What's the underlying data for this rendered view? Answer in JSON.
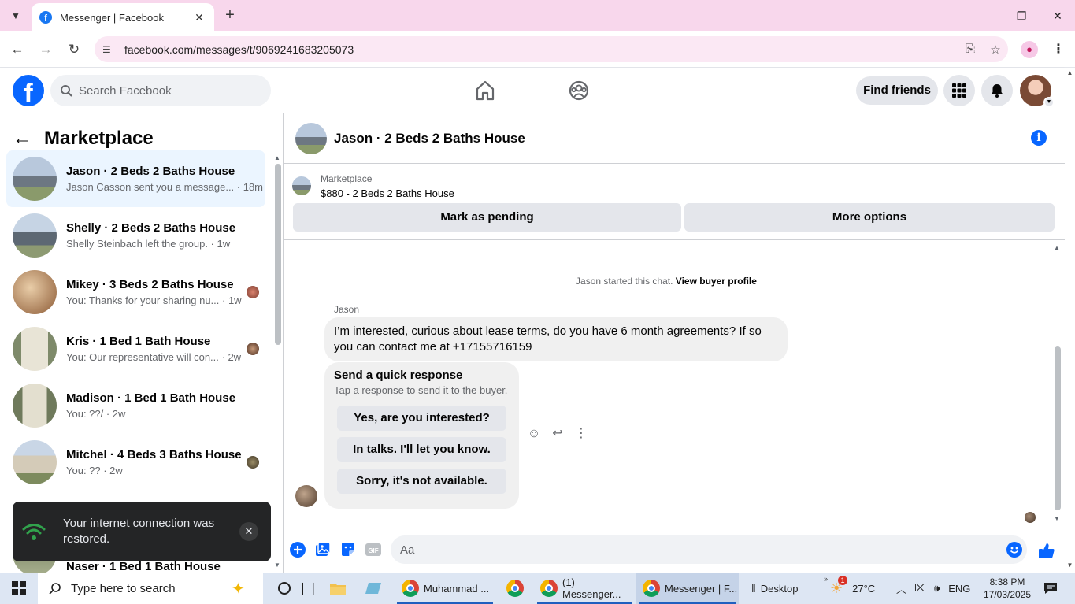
{
  "browser": {
    "tab_title": "Messenger | Facebook",
    "url": "facebook.com/messages/t/9069241683205073"
  },
  "header": {
    "search_placeholder": "Search Facebook",
    "find_friends": "Find friends"
  },
  "sidebar": {
    "title": "Marketplace",
    "conversations": [
      {
        "name": "Jason · 2 Beds 2 Baths House",
        "preview": "Jason Casson sent you a message... · 18m",
        "active": true
      },
      {
        "name": "Shelly · 2 Beds 2 Baths House",
        "preview": "Shelly Steinbach left the group. · 1w"
      },
      {
        "name": "Mikey · 3 Beds 2 Baths House",
        "preview": "You: Thanks for your sharing nu... · 1w"
      },
      {
        "name": "Kris · 1 Bed 1 Bath House",
        "preview": "You: Our representative will con... · 2w"
      },
      {
        "name": "Madison · 1 Bed 1 Bath House",
        "preview": "You: ??/ · 2w"
      },
      {
        "name": "Mitchel · 4 Beds 3 Baths House",
        "preview": "You: ?? · 2w"
      },
      {
        "name": "Naser · 1 Bed 1 Bath House",
        "preview": ""
      }
    ]
  },
  "toast": {
    "message": "Your internet connection was restored."
  },
  "chat": {
    "title": "Jason · 2 Beds 2 Baths House",
    "listing_label": "Marketplace",
    "listing_price": "$880 - 2 Beds 2 Baths House",
    "mark_pending": "Mark as pending",
    "more_options": "More options",
    "started_text": "Jason started this chat.",
    "view_buyer": "View buyer profile",
    "sender": "Jason",
    "message": "I’m interested, curious about lease terms, do you have 6 month agreements? If so you can contact me at +17155716159",
    "quick_title": "Send a quick response",
    "quick_sub": "Tap a response to send it to the buyer.",
    "quick_options": [
      "Yes, are you interested?",
      "In talks. I'll let you know.",
      "Sorry, it's not available."
    ],
    "composer_placeholder": "Aa"
  },
  "taskbar": {
    "search_placeholder": "Type here to search",
    "items": [
      "Muhammad ...",
      "(1) Messenger...",
      "Messenger | F..."
    ],
    "desktop": "Desktop",
    "weather": "27°C",
    "weather_badge": "1",
    "lang": "ENG",
    "time": "8:38 PM",
    "date": "17/03/2025"
  },
  "colors": {
    "fb_blue": "#0866ff",
    "tab_strip": "#f8d7ec",
    "active_conv": "#ebf5ff"
  }
}
